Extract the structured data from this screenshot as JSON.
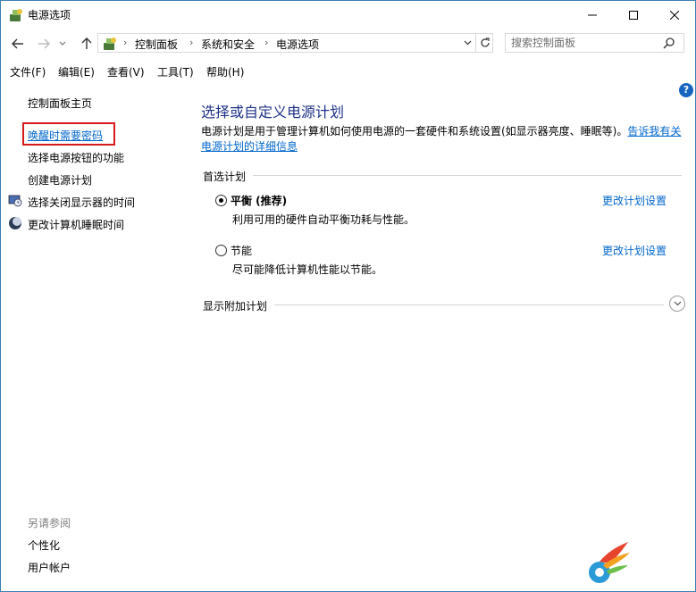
{
  "window": {
    "title": "电源选项"
  },
  "address_bar": {
    "crumbs": [
      "控制面板",
      "系统和安全",
      "电源选项"
    ],
    "search_placeholder": "搜索控制面板"
  },
  "menu": {
    "items": [
      "文件(F)",
      "编辑(E)",
      "查看(V)",
      "工具(T)",
      "帮助(H)"
    ]
  },
  "help_icon": "?",
  "sidebar": {
    "home": "控制面板主页",
    "links": [
      "唤醒时需要密码",
      "选择电源按钮的功能",
      "创建电源计划",
      "选择关闭显示器的时间",
      "更改计算机睡眠时间"
    ],
    "see_also_title": "另请参阅",
    "see_also": [
      "个性化",
      "用户帐户"
    ]
  },
  "main": {
    "title": "选择或自定义电源计划",
    "description": "电源计划是用于管理计算机如何使用电源的一套硬件和系统设置(如显示器亮度、睡眠等)。",
    "description_link_1": "告诉我有关",
    "description_link_2": "电源计划的详细信息",
    "preferred_plans": "首选计划",
    "plans": [
      {
        "name": "平衡 (推荐)",
        "desc": "利用可用的硬件自动平衡功耗与性能。",
        "link": "更改计划设置",
        "selected": true
      },
      {
        "name": "节能",
        "desc": "尽可能降低计算机性能以节能。",
        "link": "更改计划设置",
        "selected": false
      }
    ],
    "additional_plans": "显示附加计划"
  },
  "colors": {
    "link": "#0066cc",
    "title": "#1e3287",
    "highlight_border": "#d7191a",
    "window_border": "#3c7fb1"
  }
}
